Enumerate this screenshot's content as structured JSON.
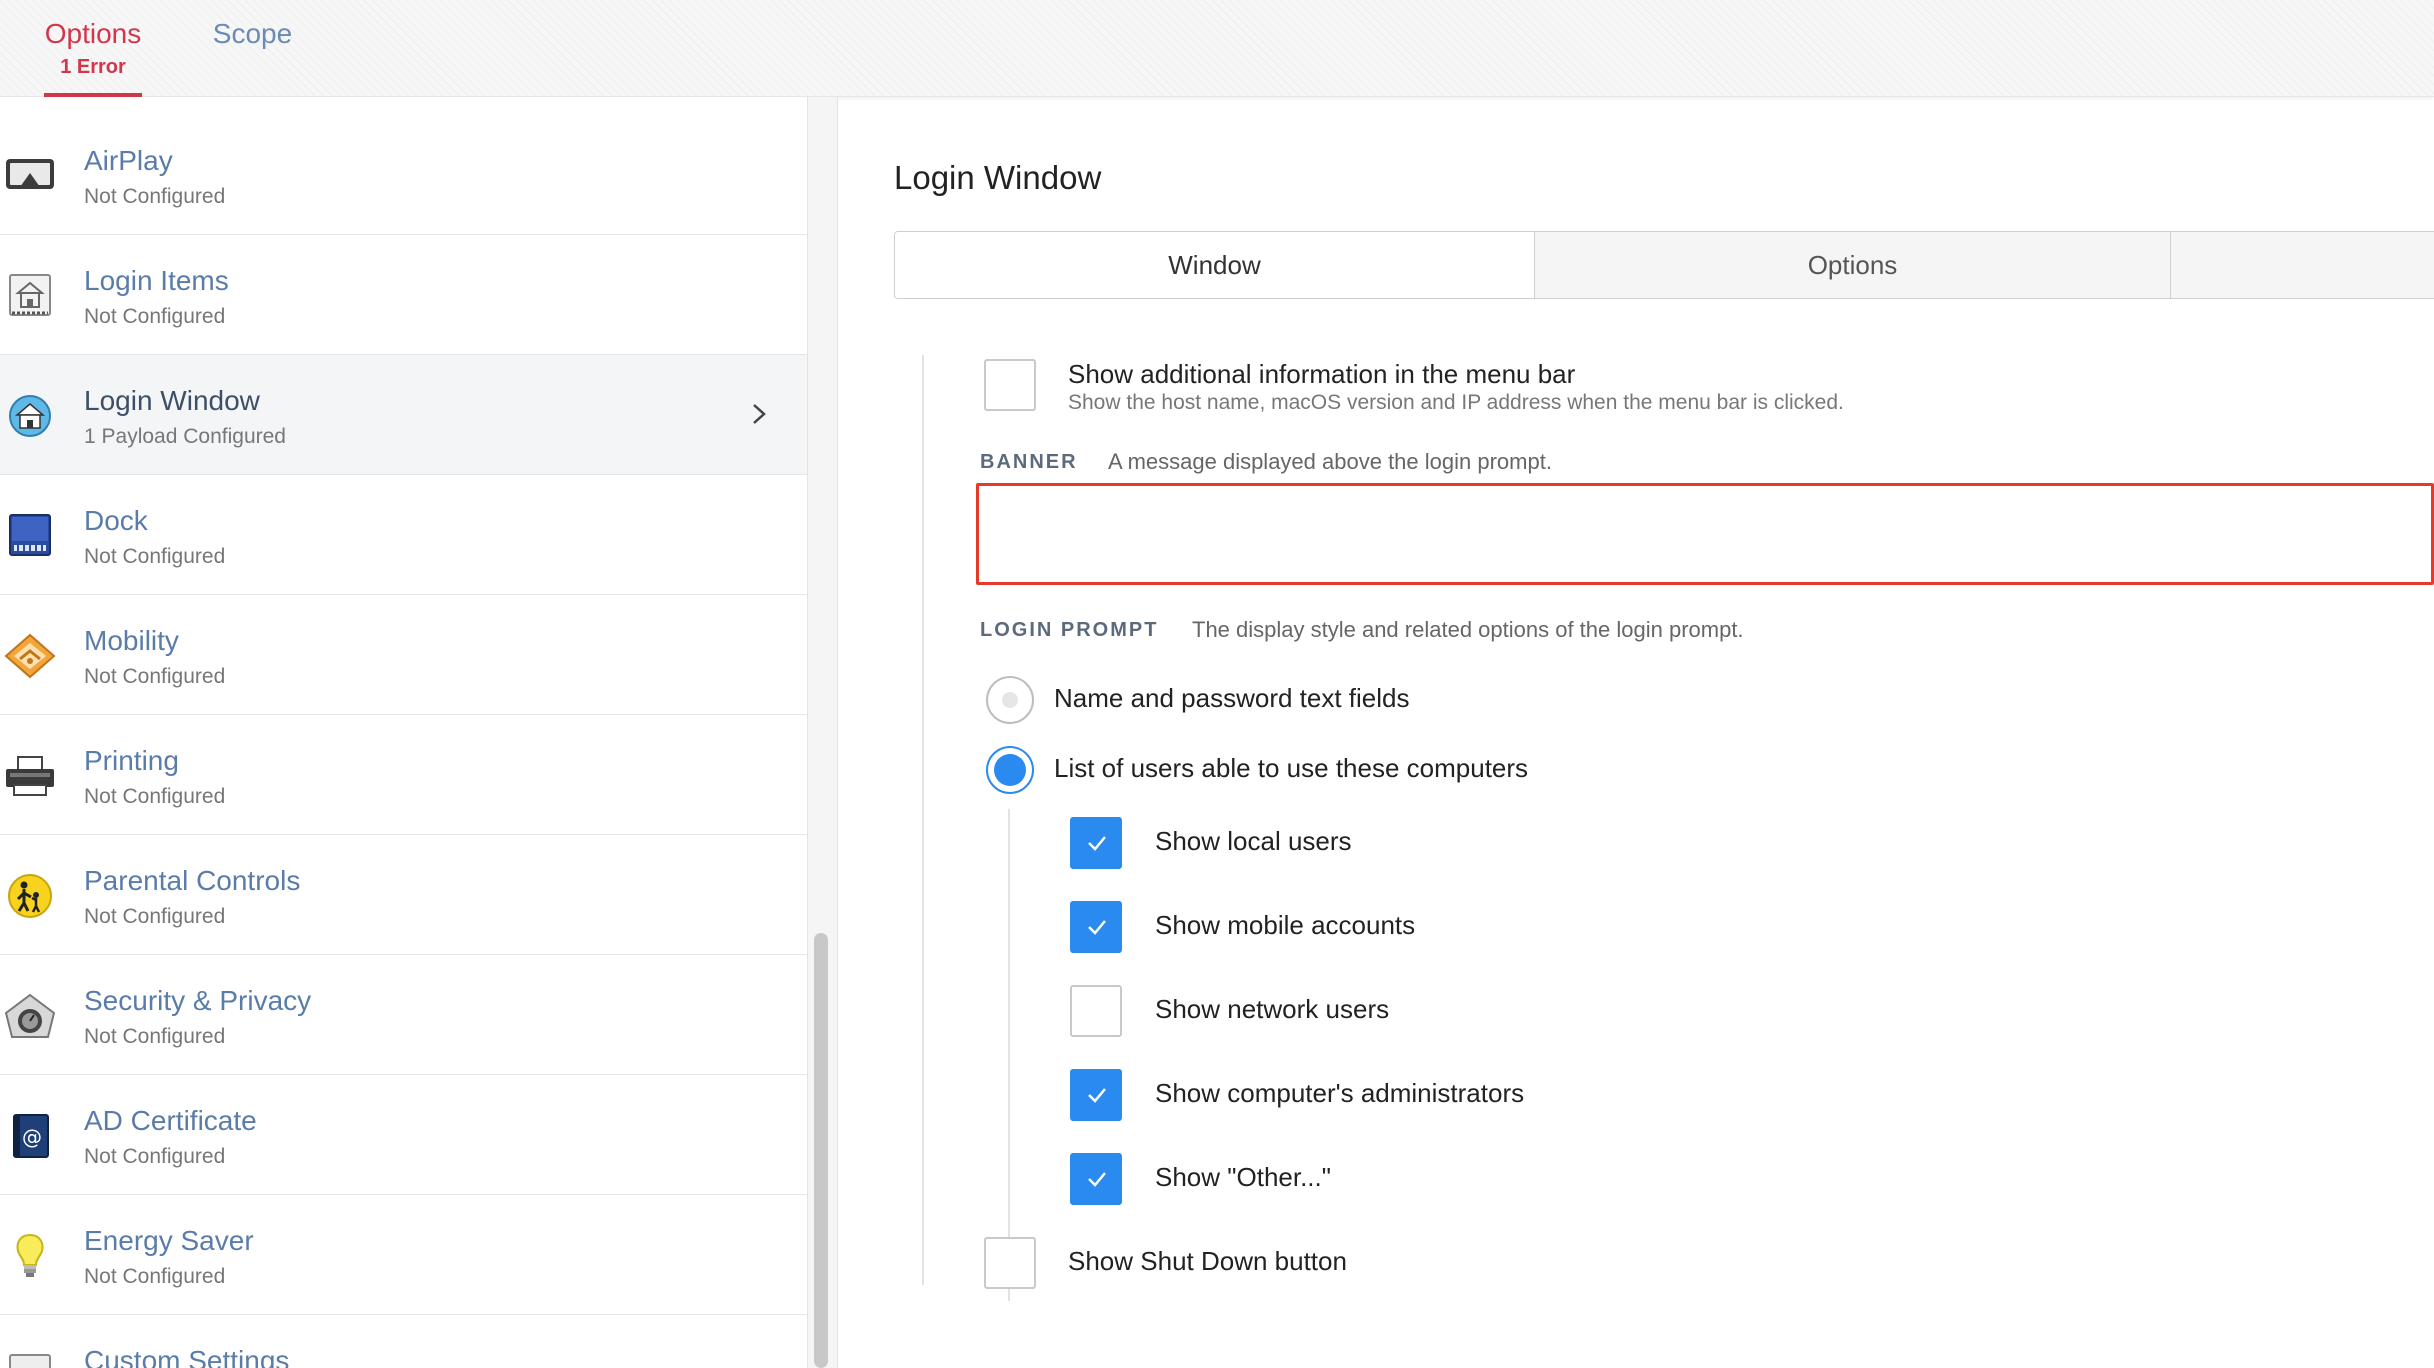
{
  "header": {
    "tabs": [
      {
        "label": "Options",
        "sublabel": "1 Error"
      },
      {
        "label": "Scope"
      }
    ]
  },
  "sidebar": {
    "items": [
      {
        "label": "AirPlay",
        "status": "Not Configured",
        "icon": "airplay-icon"
      },
      {
        "label": "Login Items",
        "status": "Not Configured",
        "icon": "login-items-icon"
      },
      {
        "label": "Login Window",
        "status": "1 Payload Configured",
        "icon": "login-window-icon",
        "selected": true
      },
      {
        "label": "Dock",
        "status": "Not Configured",
        "icon": "dock-icon"
      },
      {
        "label": "Mobility",
        "status": "Not Configured",
        "icon": "mobility-icon"
      },
      {
        "label": "Printing",
        "status": "Not Configured",
        "icon": "printer-icon"
      },
      {
        "label": "Parental Controls",
        "status": "Not Configured",
        "icon": "parental-controls-icon"
      },
      {
        "label": "Security & Privacy",
        "status": "Not Configured",
        "icon": "security-privacy-icon"
      },
      {
        "label": "AD Certificate",
        "status": "Not Configured",
        "icon": "ad-certificate-icon"
      },
      {
        "label": "Energy Saver",
        "status": "Not Configured",
        "icon": "energy-saver-icon"
      },
      {
        "label": "Custom Settings",
        "status": "",
        "icon": "custom-settings-icon"
      }
    ]
  },
  "main": {
    "title": "Login Window",
    "segments": [
      "Window",
      "Options"
    ],
    "menu_bar_info": {
      "label": "Show additional information in the menu bar",
      "description": "Show the host name, macOS version and IP address when the menu bar is clicked.",
      "checked": false
    },
    "banner": {
      "label": "BANNER",
      "description": "A message displayed above the login prompt.",
      "value": "",
      "placeholder": ""
    },
    "login_prompt": {
      "label": "LOGIN PROMPT",
      "description": "The display style and related options of the login prompt.",
      "options": [
        {
          "label": "Name and password text fields",
          "selected": false
        },
        {
          "label": "List of users able to use these computers",
          "selected": true
        }
      ],
      "sub_options": [
        {
          "label": "Show local users",
          "checked": true
        },
        {
          "label": "Show mobile accounts",
          "checked": true
        },
        {
          "label": "Show network users",
          "checked": false
        },
        {
          "label": "Show computer's administrators",
          "checked": true
        },
        {
          "label": "Show \"Other...\"",
          "checked": true
        }
      ]
    },
    "shutdown": {
      "label": "Show Shut Down button",
      "checked": false
    }
  },
  "colors": {
    "accent": "#d3354a",
    "link": "#5a7ca8",
    "checkbox": "#2b8af0",
    "error": "#e53a2a"
  }
}
